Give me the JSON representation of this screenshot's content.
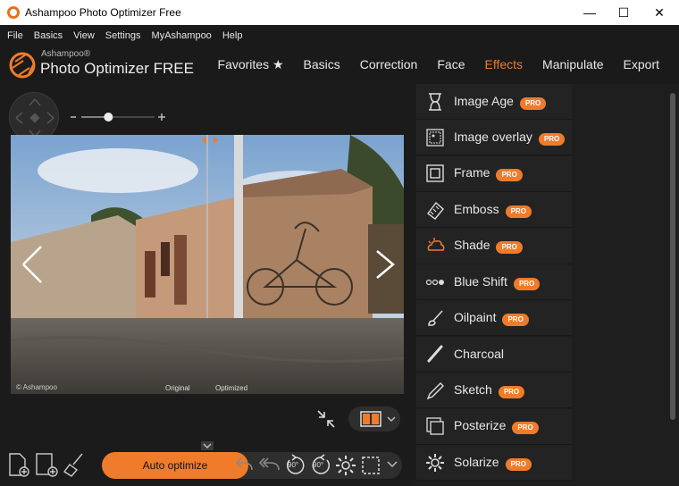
{
  "window": {
    "title": "Ashampoo Photo Optimizer Free"
  },
  "menu": [
    "File",
    "Basics",
    "View",
    "Settings",
    "MyAshampoo",
    "Help"
  ],
  "brand": {
    "small": "Ashampoo®",
    "big": "Photo Optimizer FREE"
  },
  "nav": {
    "tabs": [
      "Favorites ★",
      "Basics",
      "Correction",
      "Face",
      "Effects",
      "Manipulate",
      "Export"
    ],
    "active": "Effects"
  },
  "photo": {
    "label_left": "Original",
    "label_right": "Optimized",
    "watermark": "© Ashampoo"
  },
  "effects": [
    {
      "label": "Image Age",
      "icon": "hourglass-icon",
      "pro": "PRO"
    },
    {
      "label": "Image overlay",
      "icon": "image-overlay-icon",
      "pro": "PRO"
    },
    {
      "label": "Frame",
      "icon": "frame-icon",
      "pro": "PRO"
    },
    {
      "label": "Emboss",
      "icon": "emboss-icon",
      "pro": "PRO"
    },
    {
      "label": "Shade",
      "icon": "shade-icon",
      "pro": "PRO"
    },
    {
      "label": "Blue Shift",
      "icon": "blue-shift-icon",
      "pro": "PRO"
    },
    {
      "label": "Oilpaint",
      "icon": "brush-icon",
      "pro": "PRO"
    },
    {
      "label": "Charcoal",
      "icon": "charcoal-icon",
      "pro": ""
    },
    {
      "label": "Sketch",
      "icon": "pencil-icon",
      "pro": "PRO"
    },
    {
      "label": "Posterize",
      "icon": "posterize-icon",
      "pro": "PRO"
    },
    {
      "label": "Solarize",
      "icon": "gear-icon",
      "pro": "PRO"
    }
  ],
  "bottom": {
    "auto_optimize": "Auto optimize",
    "rotate_left": "90°",
    "rotate_right": "90°"
  },
  "zoom": {
    "level": 0.37
  },
  "colors": {
    "accent": "#f07b2a",
    "bg": "#1e1e1e"
  }
}
